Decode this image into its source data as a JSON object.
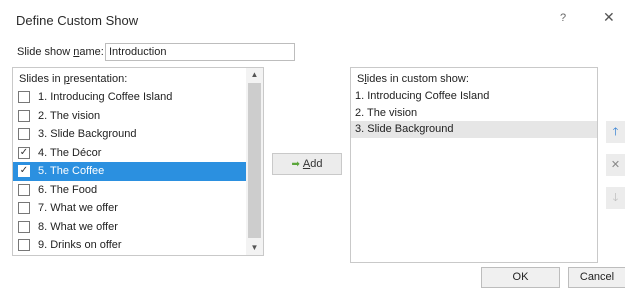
{
  "window": {
    "title": "Define Custom Show",
    "help": "?",
    "close": "✕"
  },
  "name_field": {
    "label_pre": "Slide show ",
    "label_ul": "n",
    "label_post": "ame:",
    "value": "Introduction"
  },
  "left": {
    "title_pre": "Slides in ",
    "title_ul": "p",
    "title_post": "resentation:",
    "items": [
      {
        "label": "1. Introducing Coffee Island",
        "checked": false
      },
      {
        "label": "2. The vision",
        "checked": false
      },
      {
        "label": "3. Slide Background",
        "checked": false
      },
      {
        "label": "4. The Décor",
        "checked": true
      },
      {
        "label": "5. The Coffee",
        "checked": true,
        "selected": true
      },
      {
        "label": "6. The Food",
        "checked": false
      },
      {
        "label": "7. What we offer",
        "checked": false
      },
      {
        "label": "8. What we offer",
        "checked": false
      },
      {
        "label": "9. Drinks on offer",
        "checked": false
      }
    ],
    "scroll_up": "▲",
    "scroll_down": "▼"
  },
  "add_button": {
    "arrow": "➡",
    "label_ul": "A",
    "label_post": "dd"
  },
  "right": {
    "title_pre": "S",
    "title_ul": "l",
    "title_post": "ides in custom show:",
    "items": [
      {
        "label": "1. Introducing Coffee Island",
        "highlight": false
      },
      {
        "label": "2. The vision",
        "highlight": false
      },
      {
        "label": "3. Slide Background",
        "highlight": true
      }
    ]
  },
  "side_buttons": {
    "up": "🡑",
    "remove": "✕",
    "down": "🡓"
  },
  "footer": {
    "ok": "OK",
    "cancel": "Cancel"
  }
}
